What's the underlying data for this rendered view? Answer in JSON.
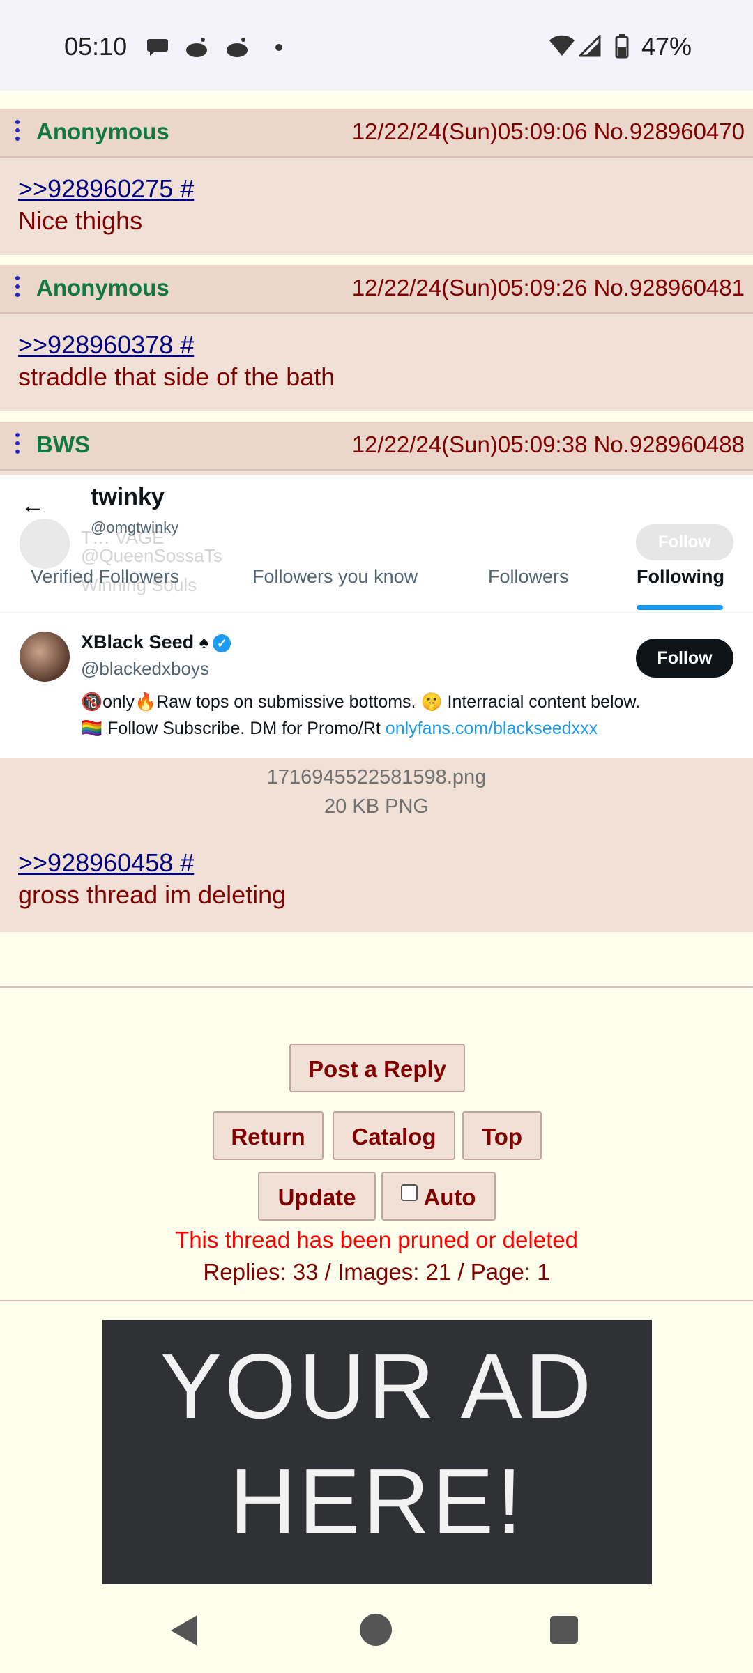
{
  "status_bar": {
    "time": "05:10",
    "battery": "47%"
  },
  "posts": [
    {
      "name": "Anonymous",
      "datetime": "12/22/24(Sun)05:09:06 No.928960470",
      "quote": ">>928960275 #",
      "text": "Nice thighs"
    },
    {
      "name": "Anonymous",
      "datetime": "12/22/24(Sun)05:09:26 No.928960481",
      "quote": ">>928960378 #",
      "text": "straddle that side of the bath"
    },
    {
      "name": "BWS",
      "datetime": "12/22/24(Sun)05:09:38 No.928960488",
      "quote": ">>928960458 #",
      "text": "gross thread im deleting"
    }
  ],
  "embedded_image": {
    "profile_name": "twinky",
    "profile_handle": "@omgtwinky",
    "ghost_text": {
      "line1": "T… VAGE",
      "line2": "@QueenSossaTs",
      "line3": "Winning Souls",
      "ghost_button": "Follow"
    },
    "tabs": [
      "Verified Followers",
      "Followers you know",
      "Followers",
      "Following"
    ],
    "active_tab": "Following",
    "user": {
      "name": "XBlack Seed",
      "handle": "@blackedxboys",
      "follow_label": "Follow",
      "bio_line1": "🔞only🔥Raw tops on submissive bottoms. 🤫 Interracial content below.",
      "bio_line2_prefix": "🏳️‍🌈 Follow Subscribe. DM for Promo/Rt ",
      "bio_link": "onlyfans.com/blackseedxxx"
    }
  },
  "file_info": {
    "filename": "1716945522581598.png",
    "size": "20 KB PNG"
  },
  "controls": {
    "post_reply": "Post a Reply",
    "return": "Return",
    "catalog": "Catalog",
    "top": "Top",
    "update": "Update",
    "auto": "Auto",
    "notice": "This thread has been pruned or deleted",
    "stats": "Replies: 33 / Images: 21 / Page: 1"
  },
  "ad": {
    "line1": "YOUR AD",
    "line2": "HERE!"
  }
}
